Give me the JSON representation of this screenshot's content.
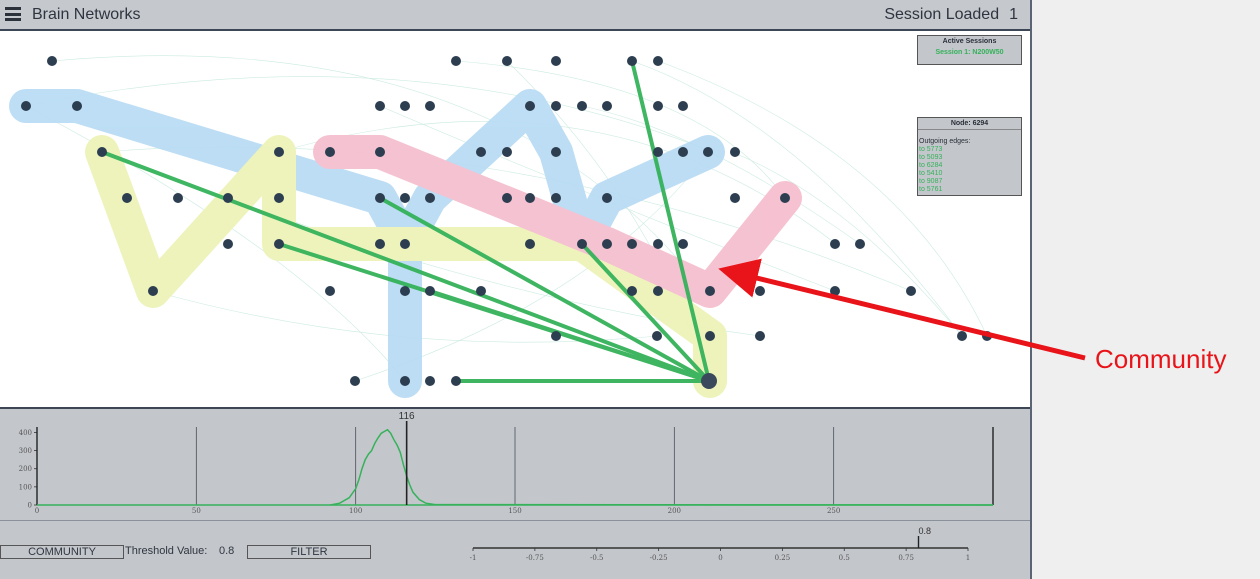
{
  "header": {
    "title": "Brain Networks",
    "session_label": "Session Loaded",
    "session_count": "1"
  },
  "sessions_panel": {
    "title": "Active Sessions",
    "items": [
      "Session 1: N200W50"
    ]
  },
  "node_panel": {
    "title": "Node: 6294",
    "subtitle": "Outgoing edges:",
    "edges": [
      "to 5773",
      "to 5093",
      "to 6284",
      "to 5410",
      "to 9087",
      "to 5761"
    ]
  },
  "histogram": {
    "type": "line",
    "x_ticks": [
      "0",
      "50",
      "100",
      "150",
      "200",
      "250"
    ],
    "y_ticks": [
      "0",
      "100",
      "200",
      "300",
      "400"
    ],
    "xlim": [
      0,
      300
    ],
    "ylim": [
      0,
      430
    ],
    "marker_value": 116,
    "marker_label": "116",
    "curve": [
      [
        92,
        0
      ],
      [
        95,
        10
      ],
      [
        98,
        40
      ],
      [
        100,
        90
      ],
      [
        101,
        140
      ],
      [
        102,
        200
      ],
      [
        103,
        250
      ],
      [
        104,
        280
      ],
      [
        105,
        300
      ],
      [
        106,
        340
      ],
      [
        107,
        370
      ],
      [
        108,
        395
      ],
      [
        109,
        405
      ],
      [
        110,
        415
      ],
      [
        111,
        395
      ],
      [
        112,
        360
      ],
      [
        113,
        330
      ],
      [
        114,
        290
      ],
      [
        115,
        220
      ],
      [
        116,
        160
      ],
      [
        117,
        110
      ],
      [
        118,
        70
      ],
      [
        120,
        30
      ],
      [
        122,
        10
      ],
      [
        125,
        2
      ],
      [
        300,
        0
      ]
    ],
    "line_color": "#35b25a"
  },
  "controls": {
    "community_button": "COMMUNITY",
    "threshold_label": "Threshold Value:",
    "threshold_value": "0.8",
    "filter_button": "FILTER",
    "slider_ticks": [
      "-1",
      "-0.75",
      "-0.5",
      "-0.25",
      "0",
      "0.25",
      "0.5",
      "0.75",
      "1"
    ],
    "slider_value": 0.8,
    "slider_value_label": "0.8"
  },
  "annotation": {
    "label": "Community",
    "color": "#e8141a"
  },
  "colors": {
    "node": "#2c3e50",
    "edge_highlight": "#35b25a",
    "community_blue": "#b9dcf4",
    "community_yellow": "#eef3b9",
    "community_pink": "#f5bfcf"
  }
}
